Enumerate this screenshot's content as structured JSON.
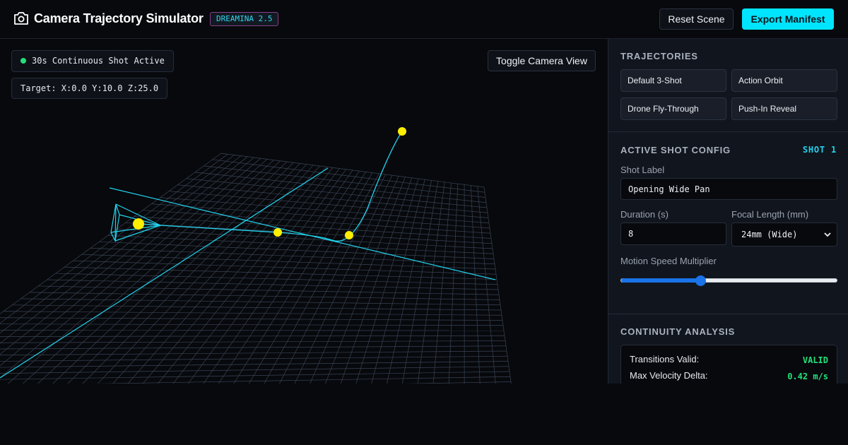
{
  "header": {
    "title": "Camera Trajectory Simulator",
    "version_badge": "DREAMINA 2.5",
    "reset_label": "Reset Scene",
    "export_label": "Export Manifest",
    "icon": "camera-icon"
  },
  "viewport": {
    "status_text": "30s Continuous Shot Active",
    "target_text": "Target: X:0.0 Y:10.0 Z:25.0",
    "toggle_label": "Toggle Camera View"
  },
  "sidebar": {
    "trajectories": {
      "title": "Trajectories",
      "items": [
        {
          "label": "Default 3-Shot"
        },
        {
          "label": "Action Orbit"
        },
        {
          "label": "Drone Fly-Through"
        },
        {
          "label": "Push-In Reveal"
        }
      ]
    },
    "shot_config": {
      "title": "Active Shot Config",
      "shot_id": "SHOT 1",
      "shot_label_label": "Shot Label",
      "shot_label_value": "Opening Wide Pan",
      "duration_label": "Duration (s)",
      "duration_value": "8",
      "focal_label": "Focal Length (mm)",
      "focal_value": "24mm (Wide)",
      "speed_label": "Motion Speed Multiplier",
      "speed_fraction": 0.37
    },
    "continuity": {
      "title": "Continuity Analysis",
      "rows": [
        {
          "label": "Transitions Valid:",
          "value": "VALID"
        },
        {
          "label": "Max Velocity Delta:",
          "value": "0.42 m/s"
        }
      ]
    }
  },
  "colors": {
    "accent": "#00e5ff",
    "path": "#22d3ee",
    "keyframe": "#ffee00",
    "status_ok": "#22e07a",
    "grid": "#3a4454"
  }
}
